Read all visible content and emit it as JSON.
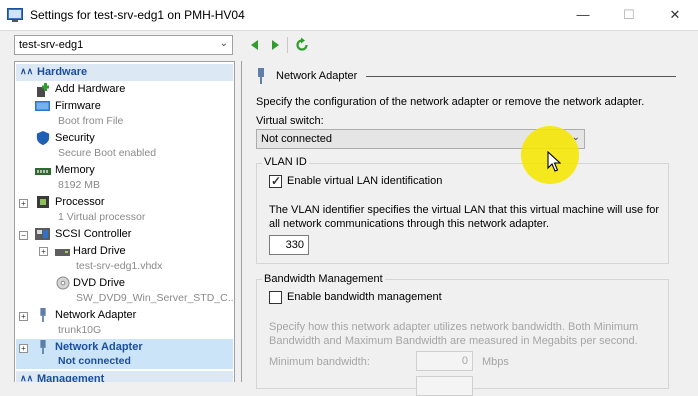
{
  "window": {
    "title": "Settings for test-srv-edg1 on PMH-HV04",
    "minimize_glyph": "—",
    "maximize_glyph": "☐",
    "close_glyph": "✕"
  },
  "toolbar": {
    "vm_select_value": "test-srv-edg1",
    "prev_icon": "triangle-left",
    "next_icon": "triangle-right",
    "refresh_icon": "refresh"
  },
  "tree": {
    "hardware_header": "Hardware",
    "management_header": "Management",
    "add_hardware": "Add Hardware",
    "firmware": "Firmware",
    "firmware_sub": "Boot from File",
    "security": "Security",
    "security_sub": "Secure Boot enabled",
    "memory": "Memory",
    "memory_sub": "8192 MB",
    "processor": "Processor",
    "processor_sub": "1 Virtual processor",
    "scsi": "SCSI Controller",
    "hard_drive": "Hard Drive",
    "hard_drive_sub": "test-srv-edg1.vhdx",
    "dvd_drive": "DVD Drive",
    "dvd_drive_sub": "SW_DVD9_Win_Server_STD_C...",
    "net1": "Network Adapter",
    "net1_sub": "trunk10G",
    "net2": "Network Adapter",
    "net2_sub": "Not connected"
  },
  "panel": {
    "section_title": "Network Adapter",
    "description": "Specify the configuration of the network adapter or remove the network adapter.",
    "virtual_switch_label": "Virtual switch:",
    "virtual_switch_value": "Not connected",
    "vlan_group_title": "VLAN ID",
    "vlan_checkbox_label": "Enable virtual LAN identification",
    "vlan_checked": true,
    "vlan_description": "The VLAN identifier specifies the virtual LAN that this virtual machine will use for all network communications through this network adapter.",
    "vlan_id": "330",
    "bandwidth_group_title": "Bandwidth Management",
    "bandwidth_checkbox_label": "Enable bandwidth management",
    "bandwidth_checked": false,
    "bandwidth_description": "Specify how this network adapter utilizes network bandwidth. Both Minimum Bandwidth and Maximum Bandwidth are measured in Megabits per second.",
    "min_bandwidth_label": "Minimum bandwidth:",
    "min_bandwidth_value": "0",
    "min_bandwidth_unit": "Mbps"
  },
  "colors": {
    "tree_header_bg": "#dde8f5",
    "tree_header_text": "#1b4e9b",
    "selected_bg": "#cce4f7",
    "nav_green": "#2f9e2f",
    "highlight_yellow": "#f5e600"
  }
}
